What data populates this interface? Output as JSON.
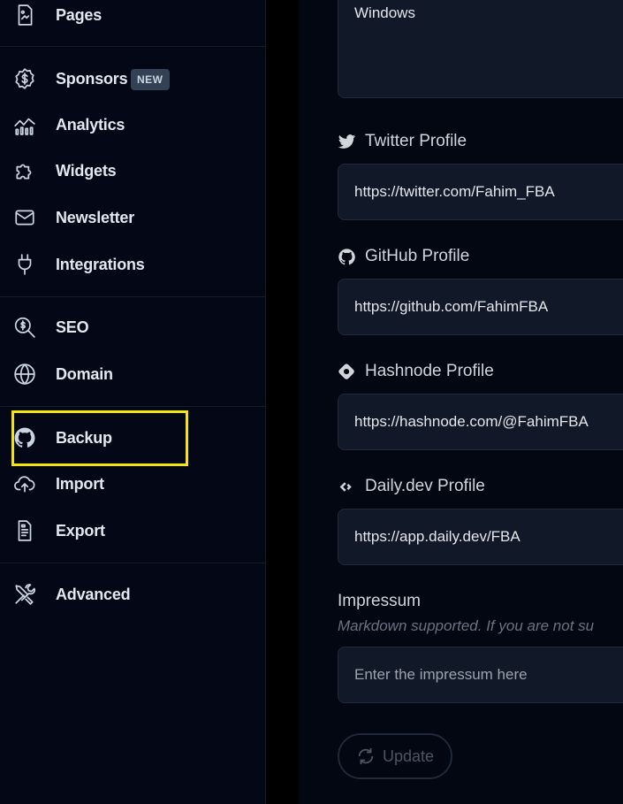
{
  "sidebar": {
    "items": [
      {
        "id": "pages",
        "label": "Pages",
        "icon": "pages-icon"
      },
      {
        "id": "sponsors",
        "label": "Sponsors",
        "icon": "dollar-badge-icon",
        "badge": "NEW"
      },
      {
        "id": "analytics",
        "label": "Analytics",
        "icon": "analytics-icon"
      },
      {
        "id": "widgets",
        "label": "Widgets",
        "icon": "puzzle-icon"
      },
      {
        "id": "newsletter",
        "label": "Newsletter",
        "icon": "mail-icon"
      },
      {
        "id": "integrations",
        "label": "Integrations",
        "icon": "plug-icon"
      },
      {
        "id": "seo",
        "label": "SEO",
        "icon": "seo-search-icon"
      },
      {
        "id": "domain",
        "label": "Domain",
        "icon": "globe-icon"
      },
      {
        "id": "backup",
        "label": "Backup",
        "icon": "github-icon"
      },
      {
        "id": "import",
        "label": "Import",
        "icon": "cloud-upload-icon"
      },
      {
        "id": "export",
        "label": "Export",
        "icon": "file-export-icon"
      },
      {
        "id": "advanced",
        "label": "Advanced",
        "icon": "tools-icon"
      }
    ],
    "highlight_color": "#f5e50d"
  },
  "form": {
    "top_field_value": "Windows",
    "twitter": {
      "label": "Twitter Profile",
      "value": "https://twitter.com/Fahim_FBA",
      "icon": "twitter-icon"
    },
    "github": {
      "label": "GitHub Profile",
      "value": "https://github.com/FahimFBA",
      "icon": "github-icon"
    },
    "hashnode": {
      "label": "Hashnode Profile",
      "value": "https://hashnode.com/@FahimFBA",
      "icon": "hashnode-icon"
    },
    "dailydev": {
      "label": "Daily.dev Profile",
      "value": "https://app.daily.dev/FBA",
      "icon": "dailydev-icon"
    },
    "impressum": {
      "label": "Impressum",
      "help": "Markdown supported. If you are not su",
      "placeholder": "Enter the impressum here"
    },
    "update_label": "Update"
  }
}
